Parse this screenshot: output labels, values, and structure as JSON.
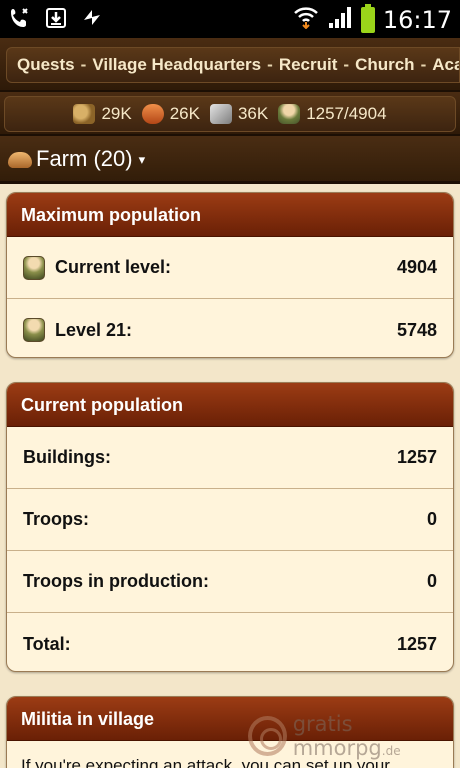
{
  "status_bar": {
    "time": "16:17",
    "icons": [
      "missed-call-icon",
      "download-icon",
      "sync-icon",
      "wifi-icon",
      "signal-icon",
      "battery-icon"
    ]
  },
  "nav": {
    "items": [
      "Quests",
      "Village Headquarters",
      "Recruit",
      "Church",
      "Aca"
    ],
    "separator": "-"
  },
  "resources": {
    "wood": "29K",
    "clay": "26K",
    "iron": "36K",
    "population": "1257/4904"
  },
  "village": {
    "title": "Farm (20)",
    "caret": "▾"
  },
  "max_population": {
    "heading": "Maximum population",
    "rows": [
      {
        "label": "Current level:",
        "value": "4904"
      },
      {
        "label": "Level 21:",
        "value": "5748"
      }
    ]
  },
  "current_population": {
    "heading": "Current population",
    "rows": [
      {
        "label": "Buildings:",
        "value": "1257"
      },
      {
        "label": "Troops:",
        "value": "0"
      },
      {
        "label": "Troops in production:",
        "value": "0"
      },
      {
        "label": "Total:",
        "value": "1257"
      }
    ]
  },
  "militia": {
    "heading": "Militia in village",
    "description": "If you're expecting an attack, you can set up your"
  },
  "watermark": {
    "text": "gratis mmorpg",
    "suffix": ".de"
  },
  "colors": {
    "panel_header": "#8a3010",
    "panel_bg": "#fff4db",
    "wood_bar": "#3d2410",
    "page_bg": "#f3e6c9"
  }
}
